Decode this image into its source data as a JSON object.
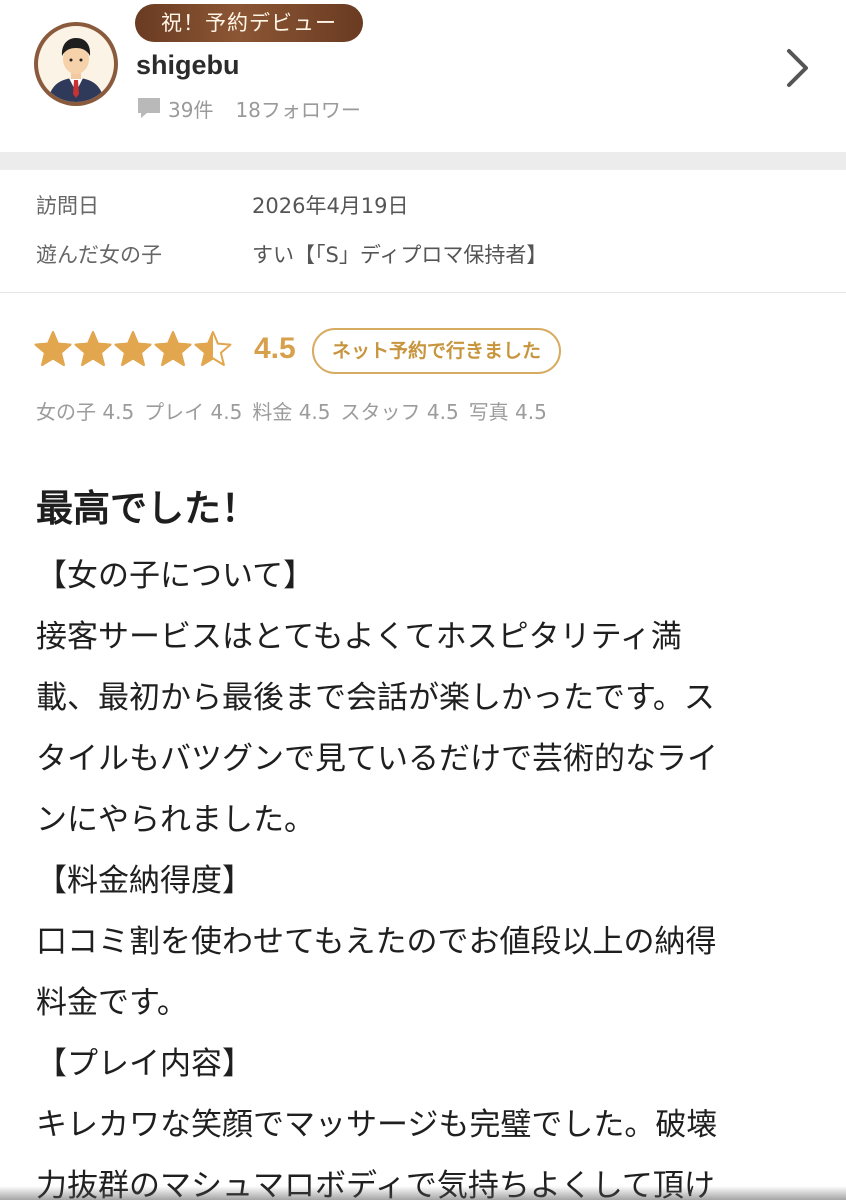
{
  "reviewer": {
    "badge": "祝！予約デビュー",
    "username": "shigebu",
    "review_count": "39件",
    "followers": "18フォロワー"
  },
  "visit": {
    "date_label": "訪問日",
    "date_value": "2026年4月19日",
    "girl_label": "遊んだ女の子",
    "girl_value": "すい【「S」ディプロマ保持者】"
  },
  "rating": {
    "overall": "4.5",
    "overall_value": 4.5,
    "reservation_tag": "ネット予約で行きました",
    "subscores": [
      "女の子 4.5",
      "プレイ 4.5",
      "料金 4.5",
      "スタッフ 4.5",
      "写真 4.5"
    ]
  },
  "review": {
    "title": "最高でした！",
    "body": "【女の子について】\n接客サービスはとてもよくてホスピタリティ満\n載、最初から最後まで会話が楽しかったです。ス\nタイルもバツグンで見ているだけで芸術的なライ\nンにやられました。\n【料金納得度】\n口コミ割を使わせてもえたのでお値段以上の納得\n料金です。\n【プレイ内容】\nキレカワな笑顔でマッサージも完璧でした。破壊\n力抜群のマシュマロボディで気持ちよくして頂け"
  },
  "icons": {
    "avatar": "man-in-suit-avatar",
    "comment": "comment-icon",
    "chevron": "chevron-right-icon",
    "star": "star-icon"
  },
  "colors": {
    "badge": "#7a4a2c",
    "star": "#e2a64e",
    "accent": "#c8953f",
    "divider": "#ececec"
  }
}
